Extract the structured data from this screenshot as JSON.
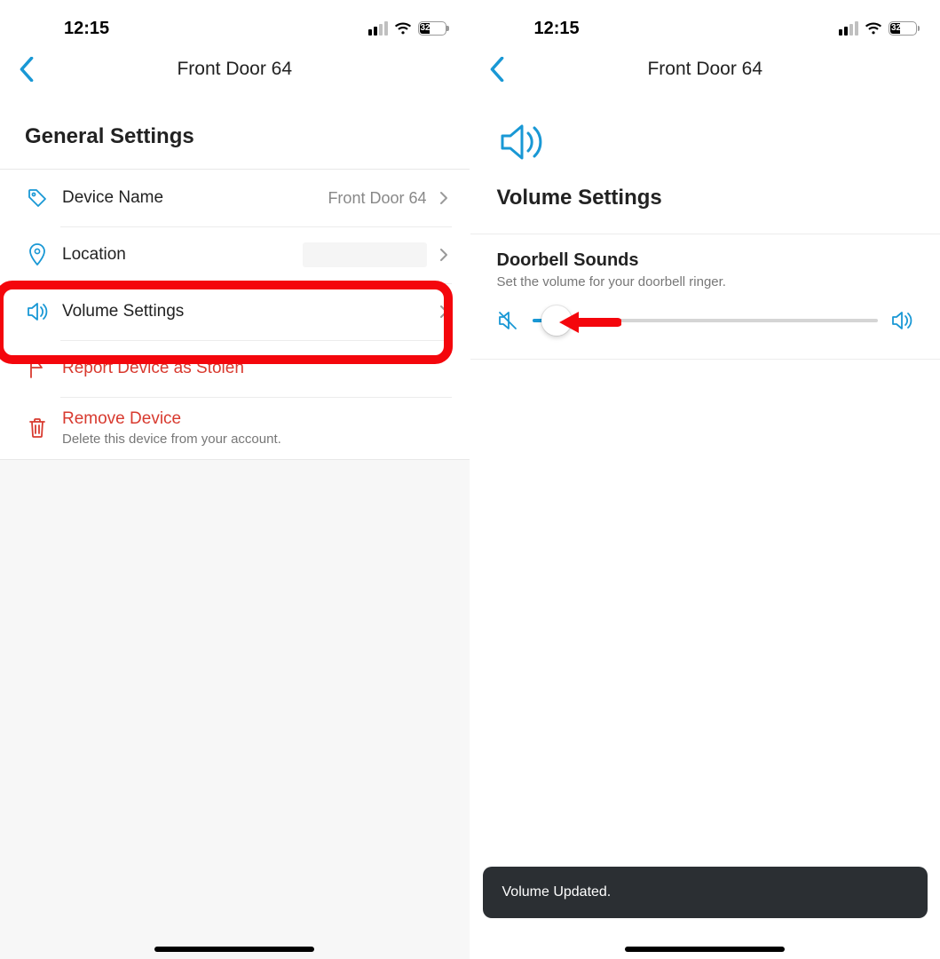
{
  "status": {
    "time": "12:15",
    "battery_pct": "32"
  },
  "left": {
    "nav_title": "Front Door 64",
    "section_title": "General Settings",
    "rows": {
      "device_name": {
        "label": "Device Name",
        "value": "Front Door 64"
      },
      "location": {
        "label": "Location"
      },
      "volume_settings": {
        "label": "Volume Settings"
      },
      "report_stolen": {
        "label": "Report Device as Stolen"
      },
      "remove": {
        "label": "Remove Device",
        "sub": "Delete this device from your account."
      }
    }
  },
  "right": {
    "nav_title": "Front Door 64",
    "title": "Volume Settings",
    "doorbell": {
      "title": "Doorbell Sounds",
      "desc": "Set the volume for your doorbell ringer.",
      "slider_pct": 7
    },
    "toast": "Volume Updated."
  },
  "colors": {
    "accent": "#1998d5",
    "danger": "#d83a2f",
    "annotation": "#f4060c"
  }
}
